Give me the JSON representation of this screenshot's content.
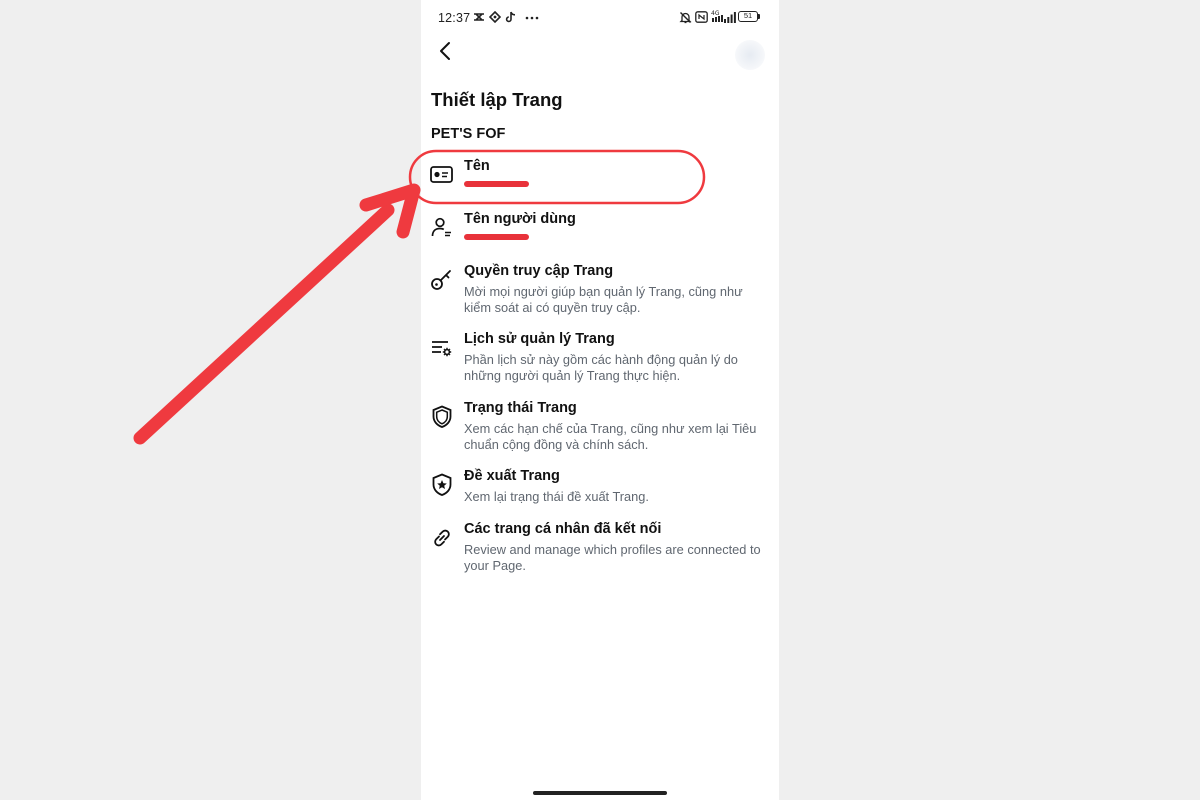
{
  "status_bar": {
    "time": "12:37",
    "icons": [
      "capcut-icon",
      "location-icon",
      "tiktok-icon",
      "more-dots-icon",
      "mute-bell-icon",
      "nfc-icon",
      "signal-4g-icon",
      "signal-bars-icon",
      "battery-icon"
    ],
    "battery_level": "51"
  },
  "header": {
    "back_icon": "chevron-left-icon"
  },
  "page": {
    "title": "Thiết lập Trang",
    "page_name": "PET'S FOF"
  },
  "menu": [
    {
      "title": "Tên",
      "icon": "id-card-icon",
      "redacted": true
    },
    {
      "title": "Tên người dùng",
      "icon": "user-icon",
      "redacted": true
    },
    {
      "title": "Quyền truy cập Trang",
      "icon": "key-icon",
      "description": "Mời mọi người giúp bạn quản lý Trang, cũng như kiểm soát ai có quyền truy cập."
    },
    {
      "title": "Lịch sử quản lý Trang",
      "icon": "list-settings-icon",
      "description": "Phần lịch sử này gồm các hành động quản lý do những người quản lý Trang thực hiện."
    },
    {
      "title": "Trạng thái Trang",
      "icon": "shield-icon",
      "description": "Xem các hạn chế của Trang, cũng như xem lại Tiêu chuẩn cộng đồng và chính sách."
    },
    {
      "title": "Đề xuất Trang",
      "icon": "shield-star-icon",
      "description": "Xem lại trạng thái đề xuất Trang."
    },
    {
      "title": "Các trang cá nhân đã kết nối",
      "icon": "link-icon",
      "description": "Review and manage which profiles are connected to your Page."
    }
  ],
  "annotation": {
    "color": "#ef3a3f",
    "highlight_icon": "highlight-ellipse-icon",
    "arrow_icon": "arrow-icon"
  }
}
